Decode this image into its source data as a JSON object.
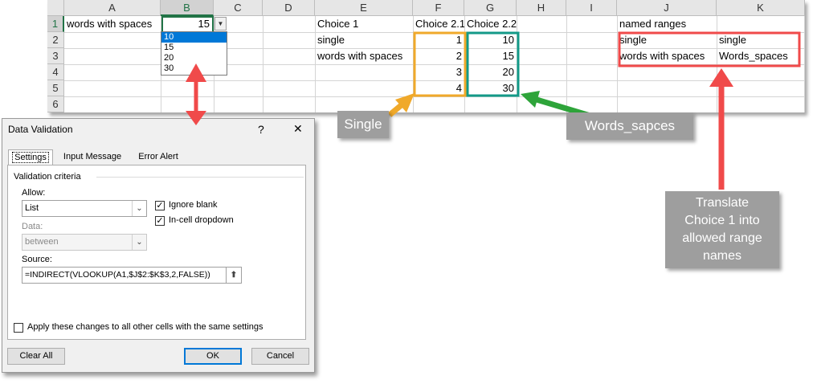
{
  "sheet": {
    "columns": [
      "A",
      "B",
      "C",
      "D",
      "E",
      "F",
      "G",
      "H",
      "I",
      "J",
      "K"
    ],
    "rows": [
      "1",
      "2",
      "3",
      "4",
      "5",
      "6"
    ],
    "cells": {
      "a1": "words with spaces",
      "b1": "15",
      "e1": "Choice 1",
      "e2": "single",
      "e3": "words with spaces",
      "f1": "Choice 2.1",
      "f2": "1",
      "f3": "2",
      "f4": "3",
      "f5": "4",
      "g1": "Choice 2.2",
      "g2": "10",
      "g3": "15",
      "g4": "20",
      "g5": "30",
      "j1": "named ranges",
      "j2": "single",
      "j3": "words with spaces",
      "k2": "single",
      "k3": "Words_spaces"
    },
    "dropdown": {
      "options": [
        "10",
        "15",
        "20",
        "30"
      ],
      "highlighted": "10",
      "arrow_icon": "chevron-down-icon"
    }
  },
  "dialog": {
    "title": "Data Validation",
    "help_label": "?",
    "close_label": "✕",
    "tabs": [
      "Settings",
      "Input Message",
      "Error Alert"
    ],
    "section_title": "Validation criteria",
    "allow_label": "Allow:",
    "allow_value": "List",
    "data_label": "Data:",
    "data_value": "between",
    "ignore_blank_label": "Ignore blank",
    "ignore_blank_checked": true,
    "in_cell_dropdown_label": "In-cell dropdown",
    "in_cell_dropdown_checked": true,
    "source_label": "Source:",
    "source_value": "=INDIRECT(VLOOKUP(A1,$J$2:$K$3,2,FALSE))",
    "apply_all_label": "Apply these changes to all other cells with the same settings",
    "apply_all_checked": false,
    "clear_all_label": "Clear All",
    "ok_label": "OK",
    "cancel_label": "Cancel"
  },
  "annotations": {
    "single_label": "Single",
    "words_label": "Words_sapces",
    "translate_label": "Translate Choice 1 into allowed range names",
    "colors": {
      "orange": "#f0a92a",
      "teal": "#139a88",
      "red": "#f04a4a",
      "green": "#2ea43a",
      "callout_gray": "#9e9e9e"
    }
  }
}
